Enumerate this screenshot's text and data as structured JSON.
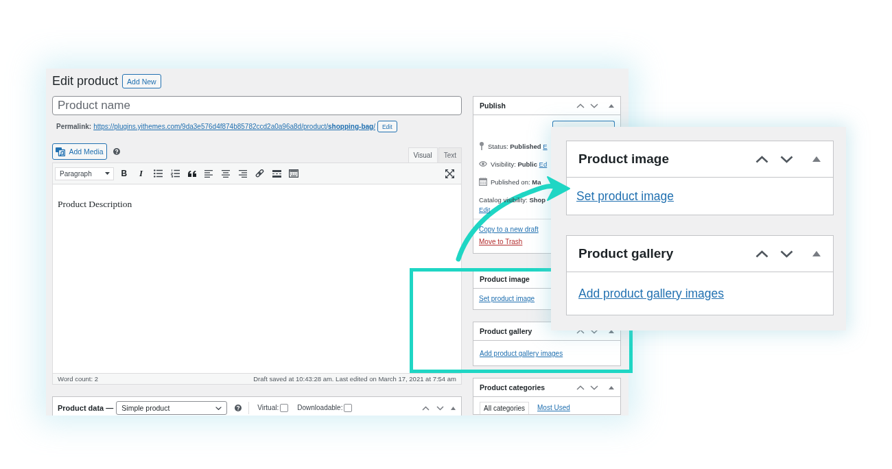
{
  "heading": {
    "title": "Edit product",
    "add_new": "Add New"
  },
  "title_field": {
    "placeholder": "Product name"
  },
  "permalink": {
    "label": "Permalink:",
    "url": "https://plugins.yithemes.com/9da3e576d4f874b85782ccd2a0a96a8d/product/**shopping-bag**/",
    "edit": "Edit"
  },
  "editor": {
    "add_media": "Add Media",
    "tabs": [
      {
        "label": "Visual",
        "selected": true
      },
      {
        "label": "Text",
        "selected": false
      }
    ],
    "toolbar": {
      "format": "Paragraph",
      "bold": "B",
      "italic": "I"
    },
    "content": "Product Description",
    "word_count": "Word count: 2",
    "save_status": "Draft saved at 10:43:28 am. Last edited on March 17, 2021 at 7:54 am"
  },
  "product_data": {
    "title": "Product data —",
    "type": "Simple product",
    "options": [
      {
        "label": "Virtual:",
        "checked": false
      },
      {
        "label": "Downloadable:",
        "checked": false
      }
    ]
  },
  "sidebar": {
    "publish": {
      "title": "Publish",
      "rows": [
        {
          "kind": "status",
          "label": "Status:",
          "value": "Published",
          "link": "E"
        },
        {
          "kind": "visibility",
          "label": "Visibility:",
          "value": "Public",
          "link": "Ed"
        },
        {
          "kind": "date",
          "label": "Published on:",
          "value": "Ma"
        }
      ],
      "catalog": {
        "label": "Catalog visibility:",
        "value": "Shop",
        "link": "Edit"
      },
      "copy_link": "Copy to a new draft",
      "trash_link": "Move to Trash"
    },
    "boxes": [
      {
        "kind": "image",
        "title": "Product image",
        "link": "Set product image"
      },
      {
        "kind": "gallery",
        "title": "Product gallery",
        "link": "Add product gallery images"
      },
      {
        "kind": "categories",
        "title": "Product categories",
        "tabs": [
          {
            "label": "All categories",
            "selected": true
          },
          {
            "label": "Most Used",
            "selected": false
          }
        ]
      }
    ]
  },
  "callout": {
    "boxes": [
      {
        "kind": "image",
        "title": "Product image",
        "link": "Set product image"
      },
      {
        "kind": "gallery",
        "title": "Product gallery",
        "link": "Add product gallery images"
      }
    ]
  }
}
